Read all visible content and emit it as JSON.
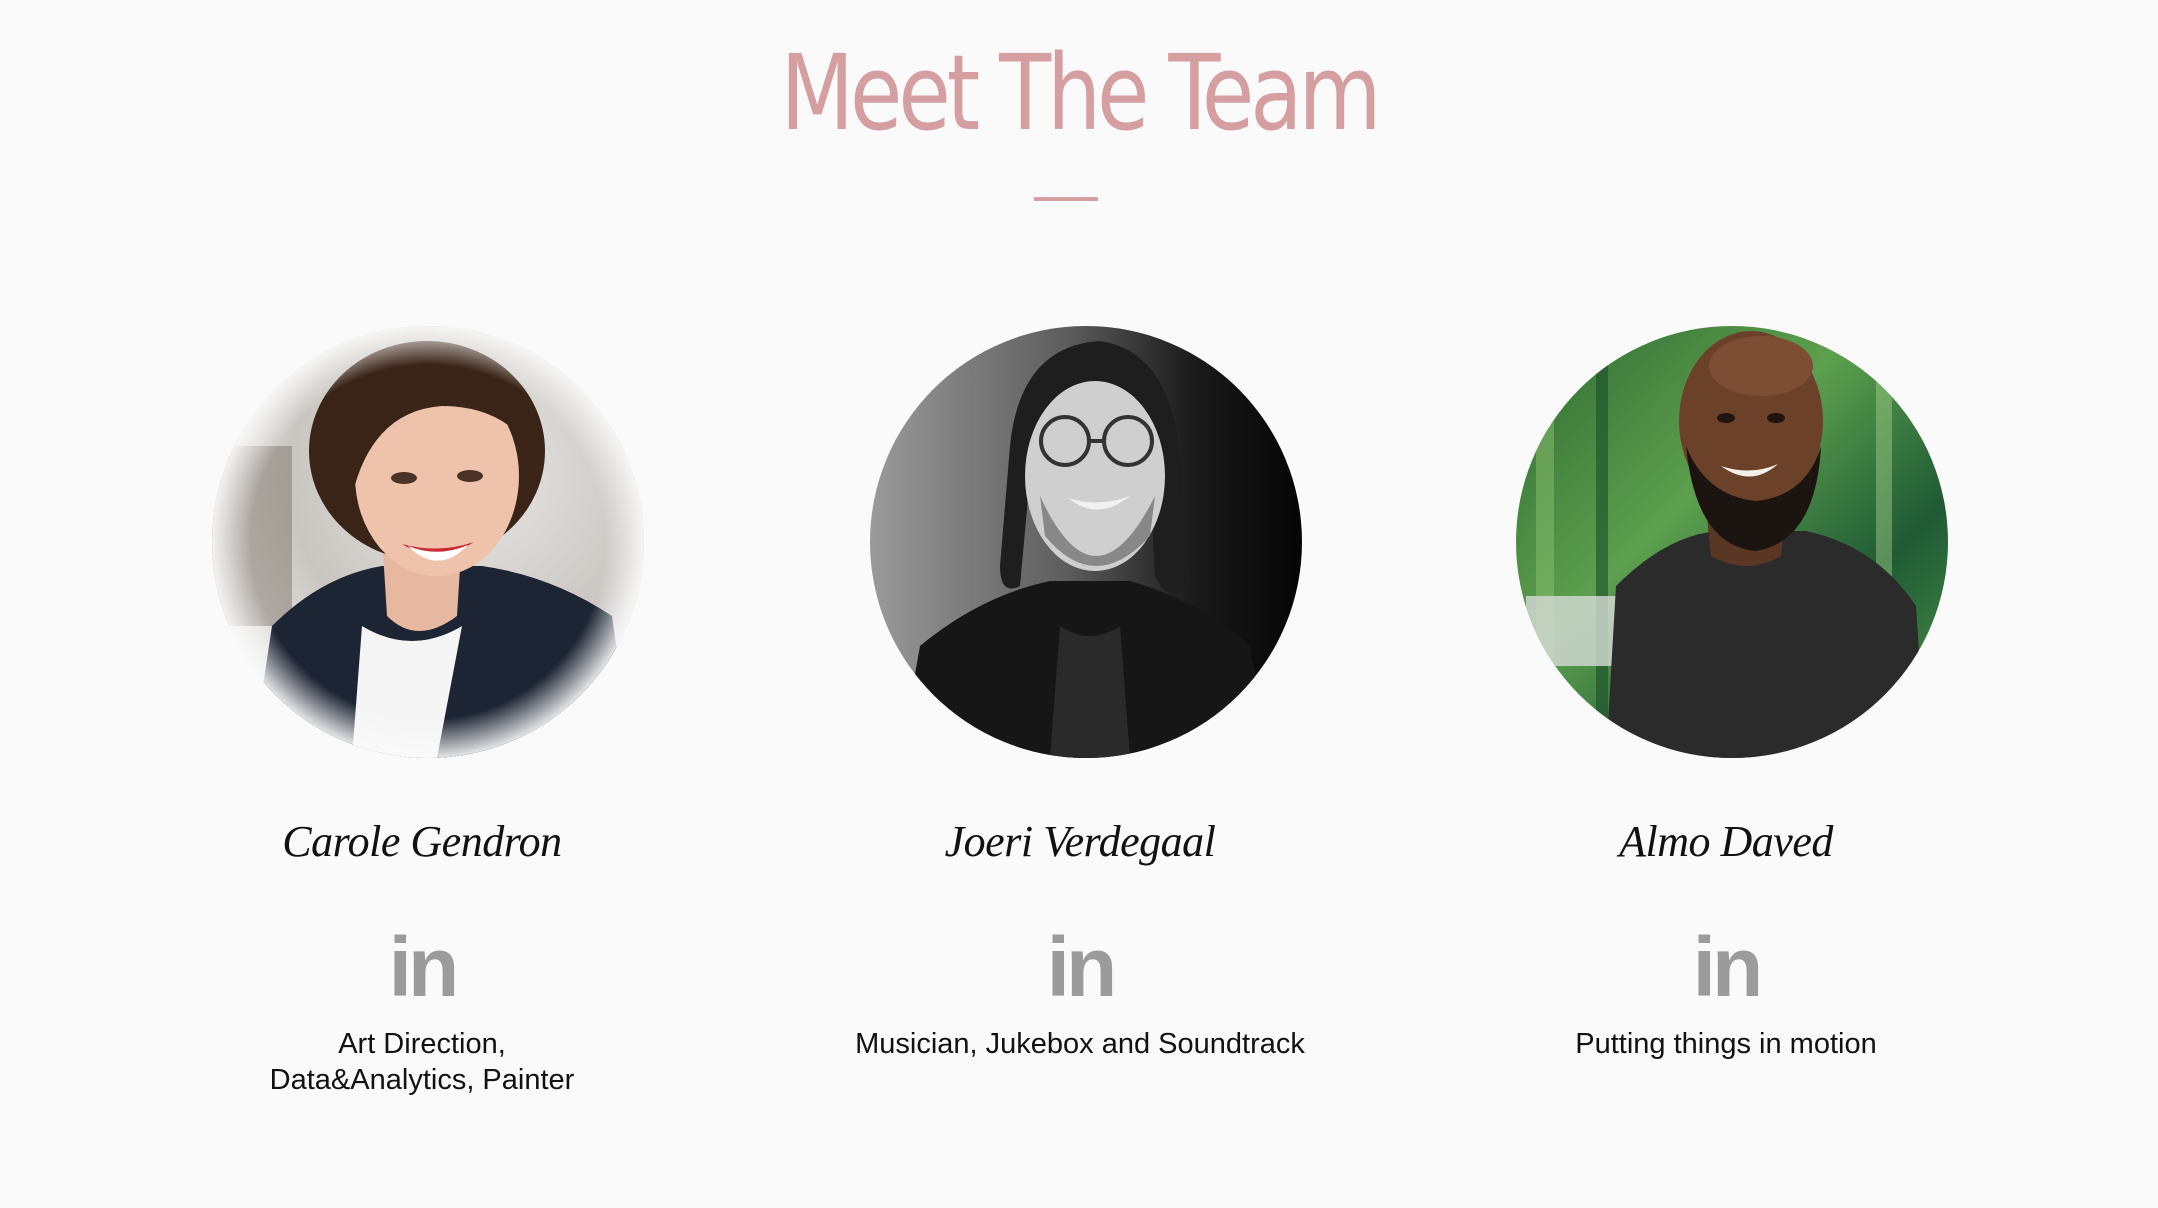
{
  "page": {
    "title": "Meet The Team",
    "accent_color": "#d59ea1",
    "icon_color": "#9b9b9b"
  },
  "team": [
    {
      "name": "Carole Gendron",
      "linkedin_icon": "in",
      "role_lines": [
        "Art Direction,",
        "Data&Analytics, Painter"
      ]
    },
    {
      "name": "Joeri Verdegaal",
      "linkedin_icon": "in",
      "role_lines": [
        "Musician, Jukebox and Soundtrack"
      ]
    },
    {
      "name": "Almo Daved",
      "linkedin_icon": "in",
      "role_lines": [
        "Putting things in motion"
      ]
    }
  ]
}
